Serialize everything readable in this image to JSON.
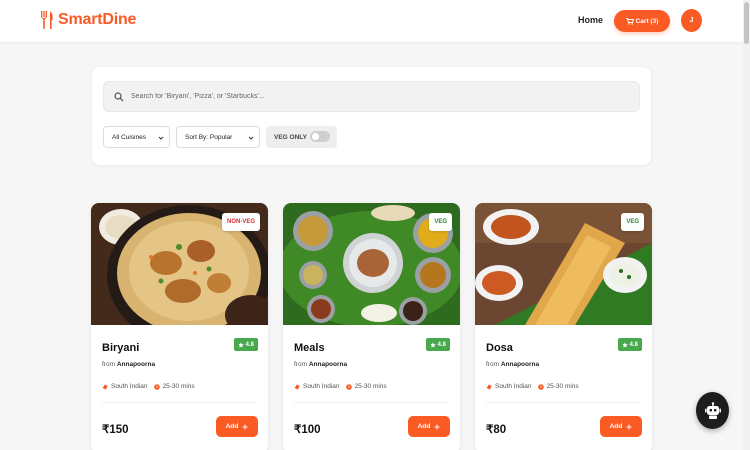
{
  "header": {
    "brand": "SmartDine",
    "nav_home": "Home",
    "cart_label": "Cart (3)",
    "avatar_initial": "J"
  },
  "search": {
    "placeholder": "Search for 'Biryani', 'Pizza', or 'Starbucks'..."
  },
  "filters": {
    "cuisine_selected": "All Cuisines",
    "sort_selected": "Sort By: Popular",
    "veg_only_label": "VEG ONLY",
    "veg_only_on": false
  },
  "items": [
    {
      "name": "Biryani",
      "tag": "NON-VEG",
      "rating": "4.8",
      "from_prefix": "from",
      "restaurant": "Annapoorna",
      "cuisine": "South Indian",
      "time": "25-30 mins",
      "price": "₹150",
      "add_label": "Add"
    },
    {
      "name": "Meals",
      "tag": "VEG",
      "rating": "4.8",
      "from_prefix": "from",
      "restaurant": "Annapoorna",
      "cuisine": "South Indian",
      "time": "25-30 mins",
      "price": "₹100",
      "add_label": "Add"
    },
    {
      "name": "Dosa",
      "tag": "VEG",
      "rating": "4.8",
      "from_prefix": "from",
      "restaurant": "Annapoorna",
      "cuisine": "South Indian",
      "time": "25-30 mins",
      "price": "₹80",
      "add_label": "Add"
    }
  ],
  "colors": {
    "accent": "#fa5a24",
    "rating_green": "#48a84d",
    "nonveg_red": "#d32f2f",
    "veg_green": "#2e7d32"
  }
}
